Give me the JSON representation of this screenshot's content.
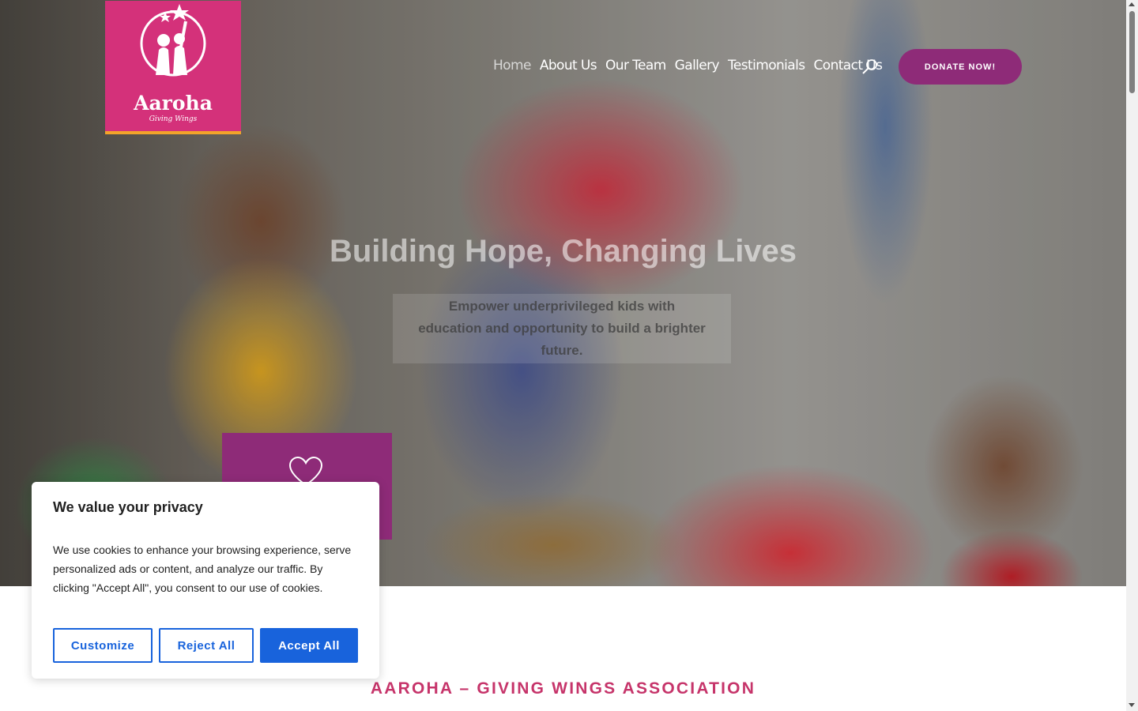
{
  "logo": {
    "title": "Aaroha",
    "tagline": "Giving Wings"
  },
  "nav": {
    "items": [
      "Home",
      "About Us",
      "Our Team",
      "Gallery",
      "Testimonials",
      "Contact Us"
    ],
    "active": "Home"
  },
  "header": {
    "search_icon": "search-icon",
    "donate_label": "DONATE NOW!"
  },
  "hero": {
    "title": "Building Hope, Changing Lives",
    "subtitle_line1": "Empower underprivileged kids with",
    "subtitle_line2": "education and opportunity to build a brighter future."
  },
  "section": {
    "heading": "AAROHA – GIVING WINGS ASSOCIATION"
  },
  "cookie": {
    "title": "We value your privacy",
    "text": "We use cookies to enhance your browsing experience, serve personalized ads or content, and analyze our traffic. By clicking \"Accept All\", you consent to our use of cookies.",
    "customize_label": "Customize",
    "reject_label": "Reject All",
    "accept_label": "Accept All"
  },
  "colors": {
    "brand_pink": "#d4317a",
    "brand_purple": "#8e2b78",
    "accent_orange": "#f2a42a",
    "cookie_blue": "#1863dc",
    "heading_pink": "#c6346a"
  }
}
